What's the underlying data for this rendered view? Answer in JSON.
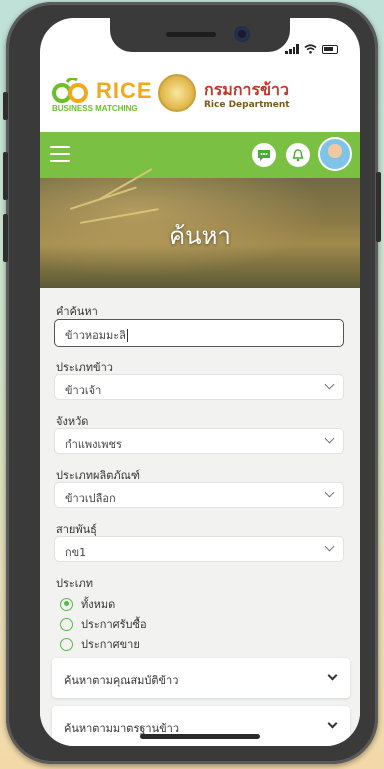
{
  "brand": {
    "rbm_name": "RICE",
    "rbm_sub": "BUSINESS MATCHING",
    "dept_title": "กรมการข้าว",
    "dept_sub": "Rice Department"
  },
  "hero": {
    "title": "ค้นหา"
  },
  "form": {
    "keyword": {
      "label": "คำค้นหา",
      "value": "ข้าวหอมมะลิ"
    },
    "rice_type": {
      "label": "ประเภทข้าว",
      "value": "ข้าวเจ้า"
    },
    "province": {
      "label": "จังหวัด",
      "value": "กำแพงเพชร"
    },
    "product_type": {
      "label": "ประเภทผลิตภัณฑ์",
      "value": "ข้าวเปลือก"
    },
    "variety": {
      "label": "สายพันธุ์",
      "value": "กข1"
    },
    "kind": {
      "label": "ประเภท",
      "options": [
        {
          "label": "ทั้งหมด",
          "selected": true
        },
        {
          "label": "ประกาศรับซื้อ",
          "selected": false
        },
        {
          "label": "ประกาศขาย",
          "selected": false
        }
      ]
    },
    "accordions": [
      {
        "label": "ค้นหาตามคุณสมบัติข้าว"
      },
      {
        "label": "ค้นหาตามมาตรฐานข้าว"
      }
    ]
  },
  "colors": {
    "nav_green": "#7ac043",
    "radio_green": "#58b948",
    "dept_red": "#c0392b",
    "rice_orange": "#f3a71c"
  },
  "icons": [
    "menu-icon",
    "chat-icon",
    "bell-icon",
    "avatar",
    "signal-icon",
    "wifi-icon",
    "battery-icon",
    "chevron-down-icon"
  ]
}
